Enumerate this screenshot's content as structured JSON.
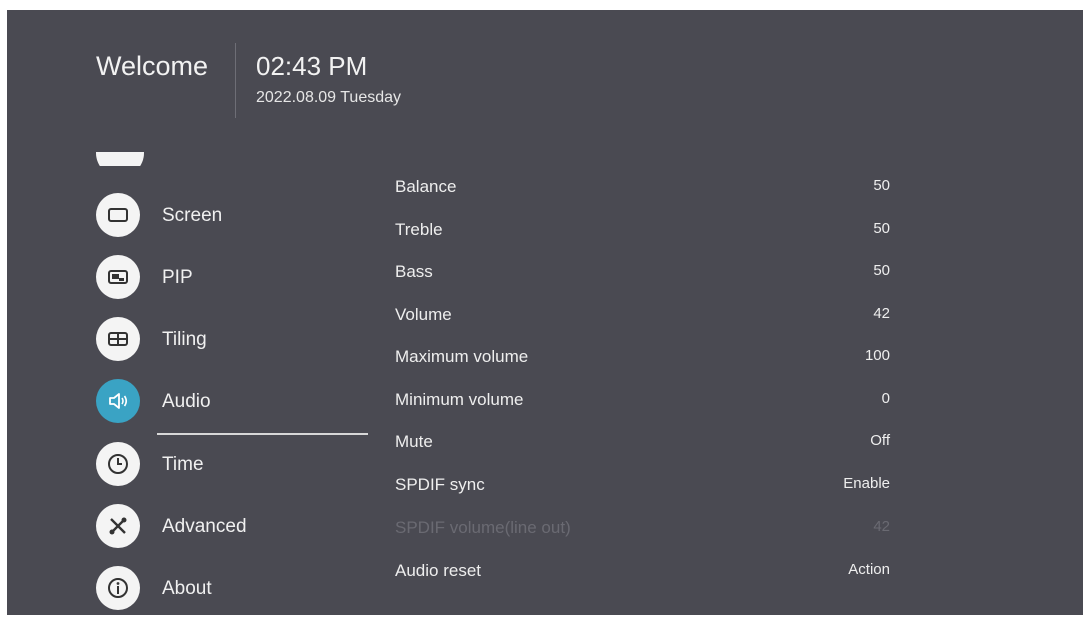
{
  "header": {
    "welcome": "Welcome",
    "time": "02:43 PM",
    "date": "2022.08.09 Tuesday"
  },
  "sidebar": {
    "items": [
      {
        "label": "Screen",
        "icon": "screen-icon"
      },
      {
        "label": "PIP",
        "icon": "pip-icon"
      },
      {
        "label": "Tiling",
        "icon": "tiling-icon"
      },
      {
        "label": "Audio",
        "icon": "speaker-icon",
        "active": true
      },
      {
        "label": "Time",
        "icon": "clock-icon"
      },
      {
        "label": "Advanced",
        "icon": "tools-icon"
      },
      {
        "label": "About",
        "icon": "info-icon"
      }
    ]
  },
  "settings": [
    {
      "name": "Balance",
      "value": "50"
    },
    {
      "name": "Treble",
      "value": "50"
    },
    {
      "name": "Bass",
      "value": "50"
    },
    {
      "name": "Volume",
      "value": "42"
    },
    {
      "name": "Maximum volume",
      "value": "100"
    },
    {
      "name": "Minimum volume",
      "value": "0"
    },
    {
      "name": "Mute",
      "value": "Off"
    },
    {
      "name": "SPDIF sync",
      "value": "Enable"
    },
    {
      "name": "SPDIF volume(line out)",
      "value": "42",
      "disabled": true
    },
    {
      "name": "Audio reset",
      "value": "Action"
    }
  ],
  "colors": {
    "background": "#4a4a52",
    "accent": "#3aa3c4",
    "icon_bg": "#f4f4f4",
    "disabled_text": "#6a6a72"
  }
}
